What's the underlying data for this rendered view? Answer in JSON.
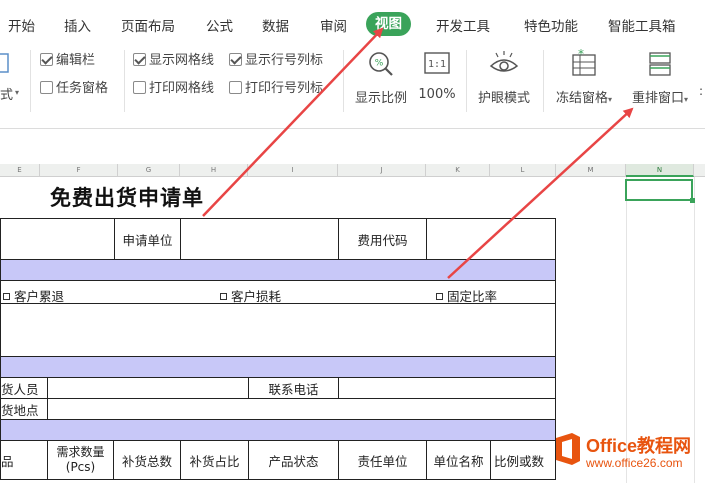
{
  "ribbon": {
    "tabs": [
      "开始",
      "插入",
      "页面布局",
      "公式",
      "数据",
      "审阅",
      "视图",
      "开发工具",
      "特色功能",
      "智能工具箱"
    ],
    "active_tab": "视图",
    "left_stub_label": "式",
    "checks": {
      "formula_bar": {
        "label": "编辑栏",
        "checked": true
      },
      "task_pane": {
        "label": "任务窗格",
        "checked": false
      },
      "show_gridlines": {
        "label": "显示网格线",
        "checked": true
      },
      "print_gridlines": {
        "label": "打印网格线",
        "checked": false
      },
      "show_headings": {
        "label": "显示行号列标",
        "checked": true
      },
      "print_headings": {
        "label": "打印行号列标",
        "checked": false
      }
    },
    "buttons": {
      "zoom": "显示比例",
      "zoom100": "100%",
      "zoom100_icon_text": "1:1",
      "eye_mode": "护眼模式",
      "freeze": "冻结窗格",
      "arrange": "重排窗口"
    }
  },
  "columns": [
    "E",
    "F",
    "G",
    "H",
    "I",
    "J",
    "K",
    "L",
    "M",
    "N"
  ],
  "sheet": {
    "title": "免费出货申请单",
    "row1": {
      "label1": "申请单位",
      "label2": "费用代码"
    },
    "options": [
      "客户累退",
      "客户损耗",
      "固定比率"
    ],
    "row_contact": {
      "label1": "货人员",
      "label2": "联系电话"
    },
    "row_address": {
      "label1": "货地点"
    },
    "table_headers": [
      "",
      "需求数量\n(Pcs)",
      "补货总数",
      "补货占比",
      "产品状态",
      "责任单位",
      "单位名称",
      "比例或数"
    ],
    "first_header_partial": "品"
  },
  "watermark": {
    "line1": "Office教程网",
    "line2": "www.office26.com"
  },
  "colors": {
    "accent_green": "#3aa35a",
    "band": "#c8c8f8",
    "arrow": "#e84545",
    "watermark": "#e8540f"
  }
}
